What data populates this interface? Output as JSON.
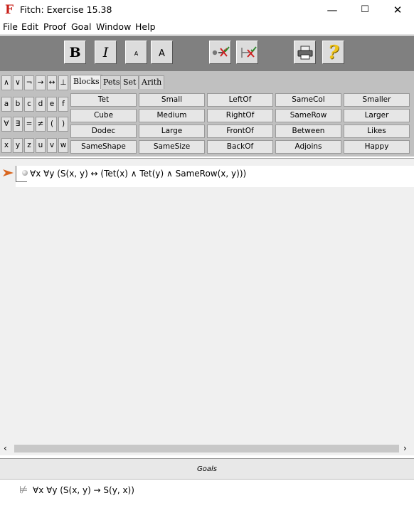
{
  "window": {
    "title": "Fitch: Exercise 15.38",
    "minimize": "—",
    "maximize": "☐",
    "close": "✕"
  },
  "menu": [
    "File",
    "Edit",
    "Proof",
    "Goal",
    "Window",
    "Help"
  ],
  "toolbar": {
    "bold": "B",
    "italic": "I",
    "small_a": "A",
    "large_a": "A"
  },
  "symbols": [
    [
      "∧",
      "∨",
      "¬",
      "→",
      "↔",
      "⊥"
    ],
    [
      "a",
      "b",
      "c",
      "d",
      "e",
      "f"
    ],
    [
      "∀",
      "∃",
      "=",
      "≠",
      "(",
      ")"
    ],
    [
      "x",
      "y",
      "z",
      "u",
      "v",
      "w"
    ]
  ],
  "tabs": [
    "Blocks",
    "Pets",
    "Set",
    "Arith"
  ],
  "predicates": [
    [
      "Tet",
      "Small",
      "LeftOf",
      "SameCol",
      "Smaller"
    ],
    [
      "Cube",
      "Medium",
      "RightOf",
      "SameRow",
      "Larger"
    ],
    [
      "Dodec",
      "Large",
      "FrontOf",
      "Between",
      "Likes"
    ],
    [
      "SameShape",
      "SameSize",
      "BackOf",
      "Adjoins",
      "Happy"
    ]
  ],
  "proof": {
    "premise": "∀x ∀y (S(x, y) ↔ (Tet(x) ∧ Tet(y) ∧ SameRow(x, y)))"
  },
  "goals": {
    "header": "Goals",
    "goal": "∀x ∀y (S(x, y) → S(y, x))"
  }
}
